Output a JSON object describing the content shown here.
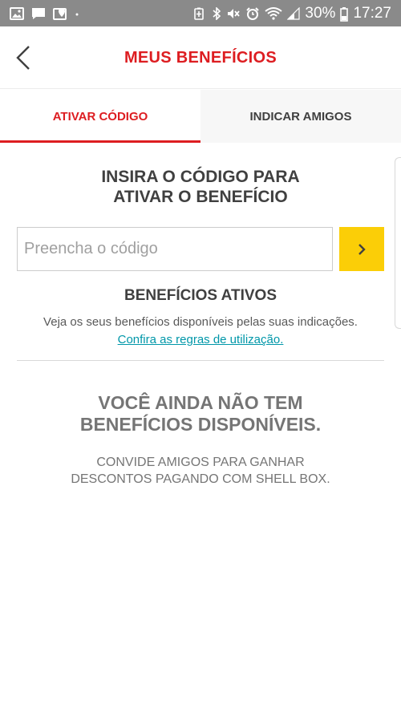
{
  "status_bar": {
    "battery_percent": "30%",
    "time": "17:27"
  },
  "header": {
    "title": "MEUS BENEFÍCIOS"
  },
  "tabs": [
    {
      "label": "ATIVAR CÓDIGO",
      "active": true
    },
    {
      "label": "INDICAR AMIGOS",
      "active": false
    }
  ],
  "activate": {
    "title_line1": "INSIRA O CÓDIGO PARA",
    "title_line2": "ATIVAR O BENEFÍCIO",
    "input_placeholder": "Preencha o código",
    "input_value": ""
  },
  "benefits": {
    "title": "BENEFÍCIOS ATIVOS",
    "description": "Veja os seus benefícios disponíveis pelas suas indicações.",
    "rules_link": "Confira as regras de utilização."
  },
  "empty_state": {
    "title_line1": "VOCÊ AINDA NÃO TEM",
    "title_line2": "BENEFÍCIOS DISPONÍVEIS.",
    "subtitle_line1": "CONVIDE AMIGOS PARA GANHAR",
    "subtitle_line2": "DESCONTOS PAGANDO COM SHELL BOX."
  },
  "colors": {
    "brand_red": "#dd1d21",
    "brand_yellow": "#fbce07",
    "link_teal": "#0097a9",
    "status_bar_gray": "#8a8a8a"
  }
}
